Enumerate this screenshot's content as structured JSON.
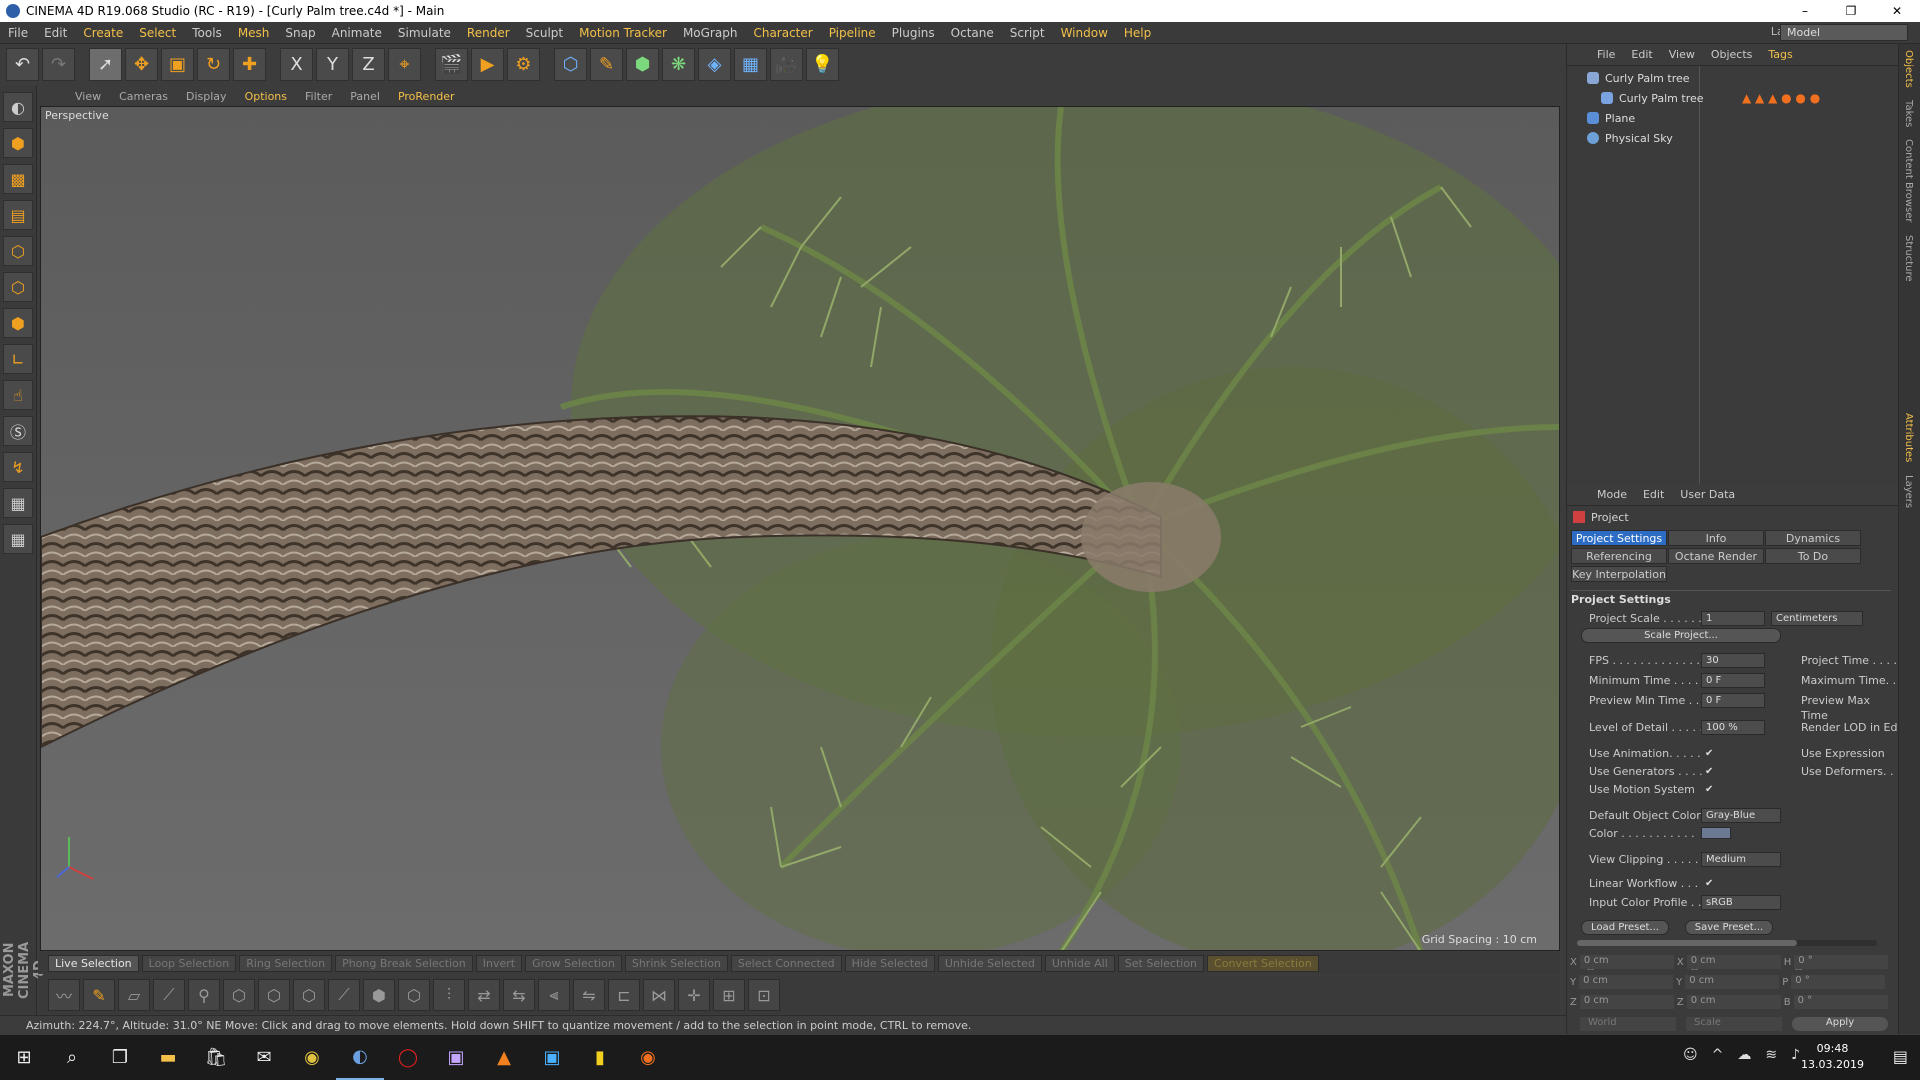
{
  "title": "CINEMA 4D R19.068 Studio (RC - R19) - [Curly Palm tree.c4d *] - Main",
  "window_buttons": [
    "–",
    "❐",
    "✕"
  ],
  "menu": {
    "items": [
      "File",
      "Edit",
      "Create",
      "Select",
      "Tools",
      "Mesh",
      "Snap",
      "Animate",
      "Simulate",
      "Render",
      "Sculpt",
      "Motion Tracker",
      "MoGraph",
      "Character",
      "Pipeline",
      "Plugins",
      "Octane",
      "Script",
      "Window",
      "Help"
    ],
    "layout_label": "Layout:",
    "layout_value": "Model"
  },
  "toolbar": {
    "axis_x": "X",
    "axis_y": "Y",
    "axis_z": "Z"
  },
  "viewport": {
    "menu": [
      "View",
      "Cameras",
      "Display",
      "Options",
      "Filter",
      "Panel",
      "ProRender"
    ],
    "label": "Perspective",
    "grid_spacing": "Grid Spacing : 10 cm"
  },
  "bottom_selection": [
    "Live Selection",
    "Loop Selection",
    "Ring Selection",
    "Phong Break Selection",
    "Invert",
    "Grow Selection",
    "Shrink Selection",
    "Select Connected",
    "Hide Selected",
    "Unhide Selected",
    "Unhide All",
    "Set Selection",
    "Convert Selection"
  ],
  "status": "Azimuth: 224.7°, Altitude: 31.0°  NE     Move: Click and drag to move elements. Hold down SHIFT to quantize movement / add to the selection in point mode, CTRL to remove.",
  "logo_text": "MAXON CINEMA 4D",
  "objects": {
    "menu": [
      "File",
      "Edit",
      "View",
      "Objects",
      "Tags"
    ],
    "rows": [
      "Curly Palm tree",
      "Curly Palm tree",
      "Plane",
      "Physical Sky"
    ]
  },
  "attributes": {
    "menu": [
      "Mode",
      "Edit",
      "User Data"
    ],
    "heading": "Project",
    "tabs": [
      "Project Settings",
      "Info",
      "Dynamics",
      "Referencing",
      "Octane Render",
      "To Do",
      "Key Interpolation"
    ],
    "section": "Project Settings",
    "project_scale_label": "Project Scale . . . . . .",
    "project_scale_value": "1",
    "project_scale_unit": "Centimeters",
    "scale_project_button": "Scale Project...",
    "fps_label": "FPS . . . . . . . . . . . . .",
    "fps_value": "30",
    "project_time_label": "Project Time . . . .",
    "min_time_label": "Minimum Time . . . .",
    "min_time_value": "0 F",
    "max_time_label": "Maximum Time. .",
    "preview_min_label": "Preview Min Time . .",
    "preview_min_value": "0 F",
    "preview_max_label": "Preview Max Time",
    "lod_label": "Level of Detail . . . . .",
    "lod_value": "100 %",
    "render_lod_label": "Render LOD in Ed",
    "use_animation_label": "Use Animation. . . . .",
    "use_expression_label": "Use Expression",
    "use_generators_label": "Use Generators . . . .",
    "use_deformers_label": "Use Deformers. .",
    "use_motion_label": "Use Motion System",
    "default_color_label": "Default Object Color",
    "default_color_value": "Gray-Blue",
    "color_label": "Color . . . . . . . . . . .",
    "view_clipping_label": "View Clipping . . . . .",
    "view_clipping_value": "Medium",
    "linear_workflow_label": "Linear Workflow . . .",
    "input_color_label": "Input Color Profile . .",
    "input_color_value": "sRGB",
    "load_preset": "Load Preset...",
    "save_preset": "Save Preset..."
  },
  "coords": {
    "rows": [
      {
        "a": "X",
        "av": "0 cm",
        "b": "X",
        "bv": "0 cm",
        "c": "H",
        "cv": "0 °"
      },
      {
        "a": "Y",
        "av": "0 cm",
        "b": "Y",
        "bv": "0 cm",
        "c": "P",
        "cv": "0 °"
      },
      {
        "a": "Z",
        "av": "0 cm",
        "b": "Z",
        "bv": "0 cm",
        "c": "B",
        "cv": "0 °"
      }
    ],
    "mode": "World",
    "scale": "Scale",
    "apply": "Apply",
    "header": [
      "--",
      "--",
      "--"
    ]
  },
  "right_tabs": [
    "Objects",
    "Takes",
    "Content Browser",
    "Structure",
    "Attributes",
    "Layers"
  ],
  "taskbar": {
    "time": "09:48",
    "date": "13.03.2019"
  },
  "colors": {
    "accent": "#f3c04a",
    "selected_tab": "#2c6cc4",
    "orange_icon": "#f0a020"
  }
}
